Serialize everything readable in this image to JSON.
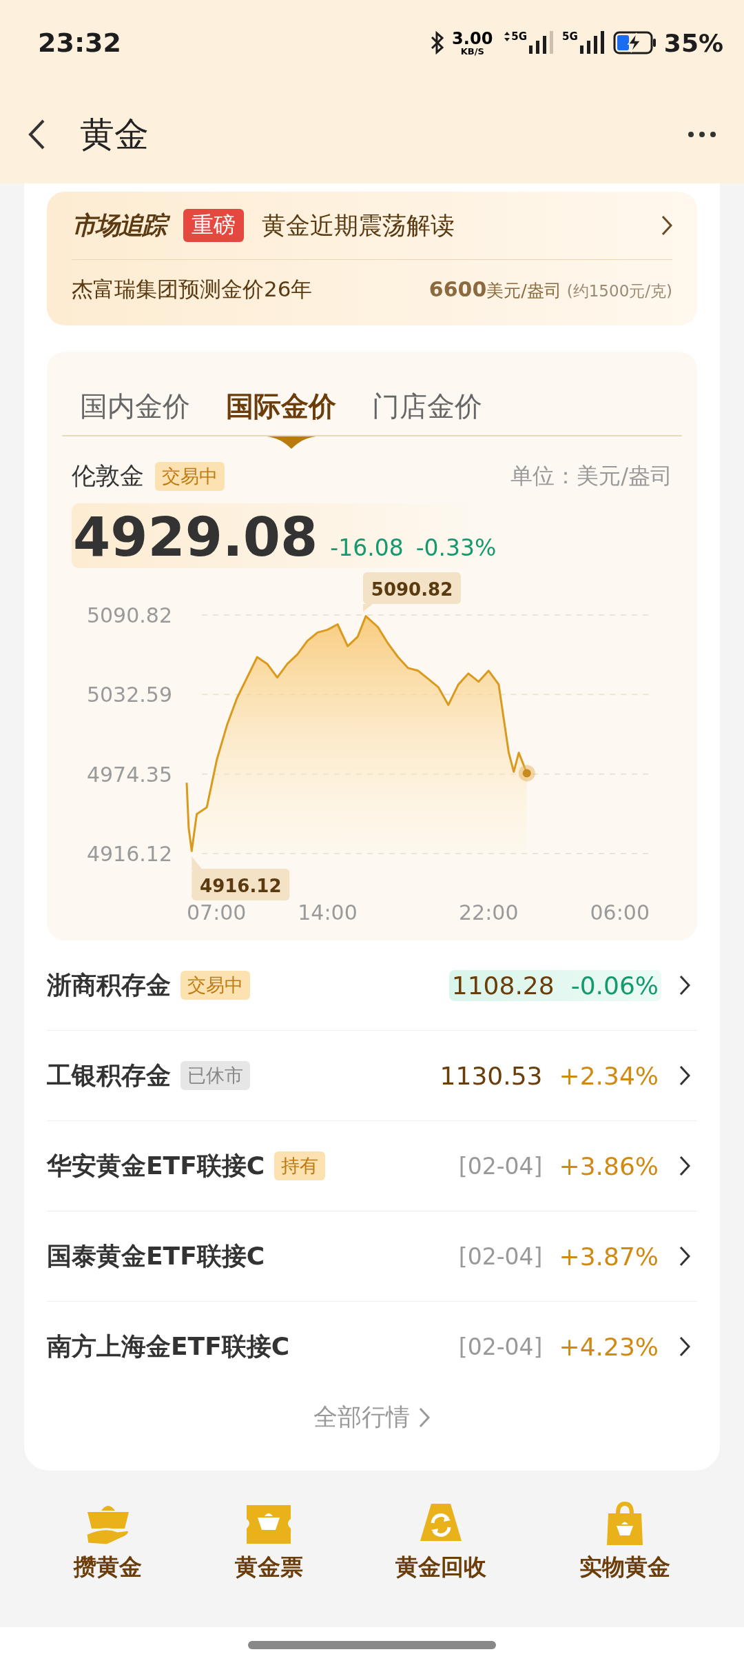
{
  "status_bar": {
    "time": "23:32",
    "net_speed": "3.00",
    "net_unit": "KB/S",
    "sims": [
      {
        "label": "5G",
        "kind": "data"
      },
      {
        "label": "5G",
        "kind": "plain"
      }
    ],
    "battery": "35%",
    "charging": true
  },
  "header": {
    "title": "黄金"
  },
  "news": {
    "brand": "市场追踪",
    "badge": "重磅",
    "headline": "黄金近期震荡解读",
    "forecast": "杰富瑞集团预测金价26年",
    "forecast_value": "6600",
    "forecast_unit": "美元/盎司",
    "forecast_note": "(约1500元/克)"
  },
  "tabs": [
    {
      "label": "国内金价",
      "selected": false
    },
    {
      "label": "国际金价",
      "selected": true
    },
    {
      "label": "门店金价",
      "selected": false
    }
  ],
  "quote": {
    "name": "伦敦金",
    "status": "交易中",
    "unit": "单位：美元/盎司",
    "price": "4929.08",
    "change": "-16.08",
    "change_pct": "-0.33%",
    "color": "#16996f"
  },
  "chart": {
    "max_label": "5090.82",
    "min_label": "4916.12",
    "x_end_label": "06:00",
    "chart_data": {
      "type": "area",
      "x": [
        7,
        7.1,
        7.25,
        7.5,
        8,
        8.5,
        9,
        9.5,
        10,
        10.5,
        11,
        11.5,
        12,
        12.5,
        13,
        13.5,
        14,
        14.5,
        15,
        15.5,
        15.9,
        16.5,
        17,
        17.5,
        18,
        18.5,
        19,
        19.5,
        20,
        20.5,
        21,
        21.5,
        22,
        22.5,
        23,
        23.25,
        23.5,
        23.9
      ],
      "series": [
        {
          "color": "#d99a1e",
          "values": [
            4968,
            4935,
            4918,
            4945,
            4950,
            4985,
            5010,
            5030,
            5045,
            5060,
            5055,
            5045,
            5055,
            5062,
            5072,
            5078,
            5080,
            5084,
            5068,
            5075,
            5090,
            5082,
            5070,
            5060,
            5052,
            5050,
            5044,
            5038,
            5025,
            5040,
            5048,
            5042,
            5050,
            5040,
            4990,
            4976,
            4990,
            4975
          ]
        }
      ],
      "xlim": [
        7,
        30
      ],
      "ylim": [
        4916.12,
        5090.82
      ],
      "xticks": [
        {
          "value": 7,
          "label": "07:00"
        },
        {
          "value": 14,
          "label": "14:00"
        },
        {
          "value": 22,
          "label": "22:00"
        }
      ],
      "yticks": [
        5090.82,
        5032.59,
        4974.35,
        4916.12
      ]
    }
  },
  "products": [
    {
      "name": "浙商积存金",
      "tag": {
        "label": "交易中",
        "kind": "trading"
      },
      "price": "1108.28",
      "change": "-0.06%",
      "color": "#16996f",
      "highlighted": true
    },
    {
      "name": "工银积存金",
      "tag": {
        "label": "已休市",
        "kind": "closed"
      },
      "price": "1130.53",
      "change": "+2.34%",
      "color": "#d08a12",
      "highlighted": false
    },
    {
      "name": "华安黄金ETF联接C",
      "tag": {
        "label": "持有",
        "kind": "holding"
      },
      "date": "[02-04]",
      "change": "+3.86%",
      "color": "#d08a12",
      "highlighted": false
    },
    {
      "name": "国泰黄金ETF联接C",
      "date": "[02-04]",
      "change": "+3.87%",
      "color": "#d08a12",
      "highlighted": false
    },
    {
      "name": "南方上海金ETF联接C",
      "date": "[02-04]",
      "change": "+4.23%",
      "color": "#d08a12",
      "highlighted": false
    }
  ],
  "more_link": "全部行情",
  "bottom_nav": [
    {
      "label": "攒黄金",
      "kind": "ingot-hand"
    },
    {
      "label": "黄金票",
      "kind": "ticket"
    },
    {
      "label": "黄金回收",
      "kind": "recycle"
    },
    {
      "label": "实物黄金",
      "kind": "bag"
    }
  ]
}
